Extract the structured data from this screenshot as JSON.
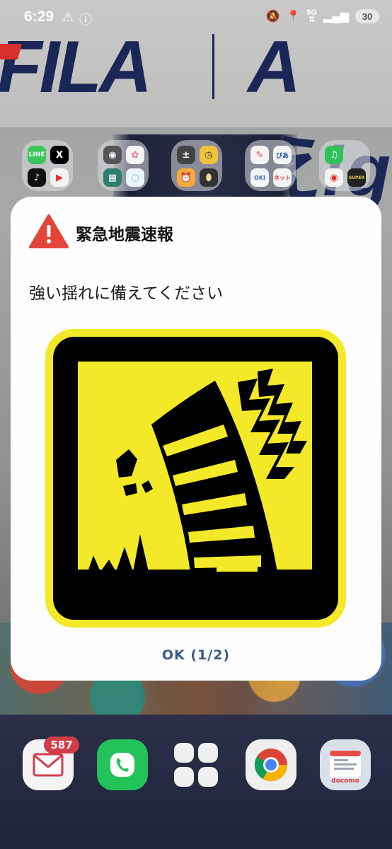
{
  "status_bar": {
    "time": "6:29",
    "network": "5G",
    "battery": "30",
    "icons": [
      "warning-icon",
      "info-icon",
      "mute-icon",
      "location-icon",
      "signal-icon"
    ]
  },
  "wallpaper": {
    "brand_left": "FILA",
    "brand_right": "Aえ!g"
  },
  "folders": [
    {
      "apps": [
        "LINE",
        "X",
        "TikTok",
        "YouTube"
      ]
    },
    {
      "apps": [
        "camera-icon",
        "photos-icon",
        "qr-icon",
        "circle-icon"
      ]
    },
    {
      "apps": [
        "calculator-icon",
        "clock-icon",
        "alarm-icon",
        "egg-icon"
      ]
    },
    {
      "apps": [
        "chat-icon",
        "ぴあ",
        "OKI",
        "ネット"
      ]
    },
    {
      "apps": [
        "music-icon",
        "youtube-music-icon",
        "SUPER"
      ]
    }
  ],
  "dialog": {
    "title": "緊急地震速報",
    "message": "強い揺れに備えてください",
    "ok_label": "OK  (1/2)",
    "icon": "earthquake-icon",
    "colors": {
      "sign_yellow": "#F3E928",
      "sign_black": "#000000",
      "warning_red": "#E3453A",
      "ok_text": "#3C5A86"
    }
  },
  "dock": {
    "mail_badge": "587",
    "apps": [
      "mail-icon",
      "phone-icon",
      "apps-grid-icon",
      "chrome-icon",
      "docomo-icon"
    ],
    "docomo_label": "docomo"
  }
}
